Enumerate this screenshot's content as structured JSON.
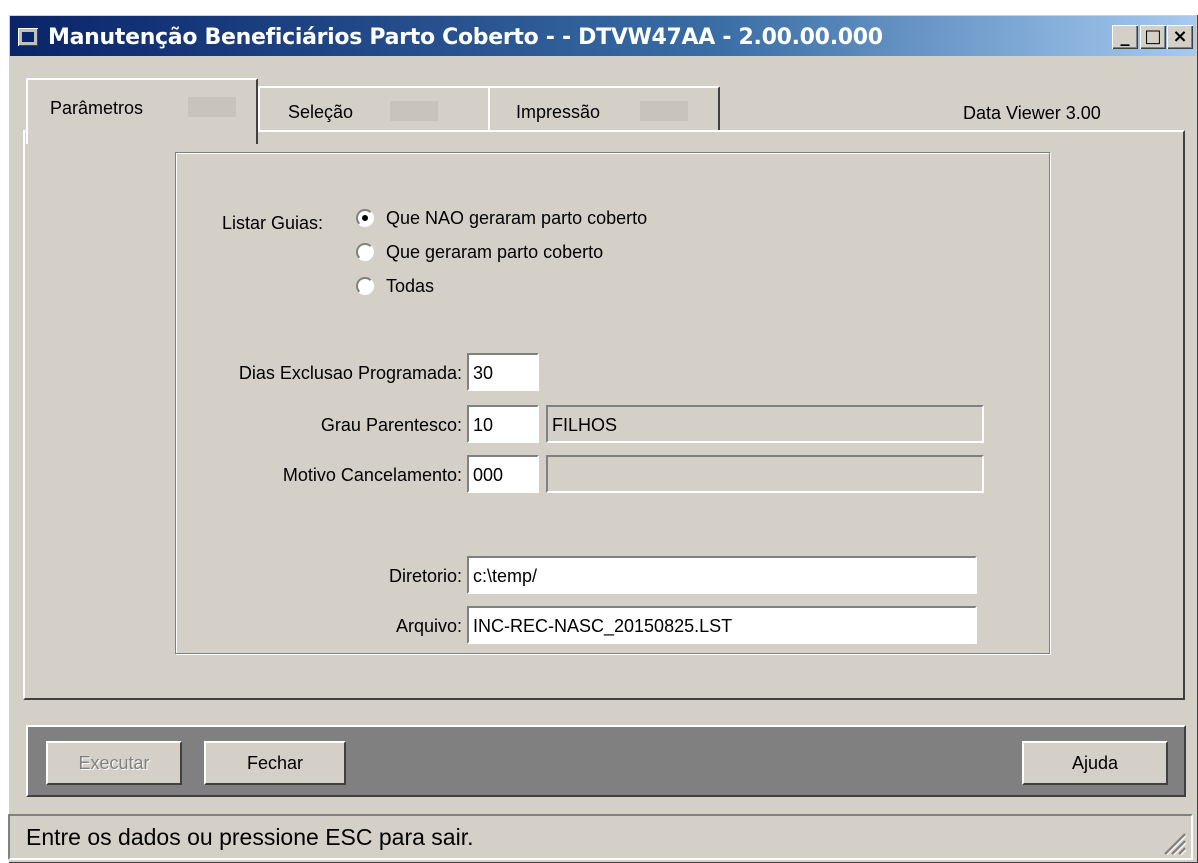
{
  "window": {
    "title": "Manutenção Beneficiários Parto Coberto - - DTVW47AA - 2.00.00.000",
    "controls": {
      "minimize": "_",
      "maximize": "□",
      "close": "×"
    }
  },
  "tabs": [
    {
      "label": "Parâmetros",
      "active": true
    },
    {
      "label": "Seleção",
      "active": false
    },
    {
      "label": "Impressão",
      "active": false
    }
  ],
  "data_viewer_label": "Data Viewer 3.00",
  "form": {
    "listar_guias": {
      "label": "Listar Guias:",
      "options": [
        {
          "label": "Que NAO geraram parto coberto",
          "selected": true
        },
        {
          "label": "Que geraram parto coberto",
          "selected": false
        },
        {
          "label": "Todas",
          "selected": false
        }
      ]
    },
    "dias_exclusao": {
      "label": "Dias Exclusao Programada:",
      "value": "30"
    },
    "grau_parentesco": {
      "label": "Grau Parentesco:",
      "code": "10",
      "description": "FILHOS"
    },
    "motivo_cancelamento": {
      "label": "Motivo Cancelamento:",
      "code": "000",
      "description": ""
    },
    "diretorio": {
      "label": "Diretorio:",
      "value": "c:\\temp/"
    },
    "arquivo": {
      "label": "Arquivo:",
      "value": "INC-REC-NASC_20150825.LST"
    }
  },
  "buttons": {
    "executar": {
      "label": "Executar",
      "enabled": false
    },
    "fechar": {
      "label": "Fechar"
    },
    "ajuda": {
      "label": "Ajuda"
    }
  },
  "status": {
    "text": "Entre os dados ou pressione ESC para sair."
  },
  "colors": {
    "title_gradient_start": "#0a246a",
    "title_gradient_end": "#a6caf0",
    "face": "#d4d0c8",
    "button_bar": "#808080"
  }
}
